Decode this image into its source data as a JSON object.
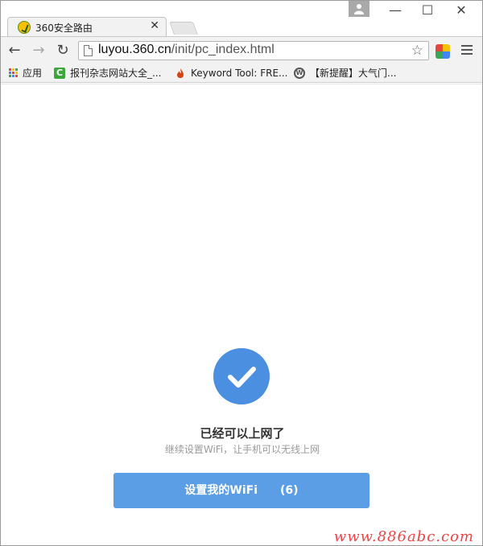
{
  "browser": {
    "tab": {
      "title": "360安全路由",
      "close": "✕"
    },
    "window_controls": {
      "minimize": "—",
      "maximize": "☐",
      "close": "✕"
    },
    "toolbar": {
      "back": "←",
      "forward": "→",
      "reload": "↻",
      "url_host": "luyou.360.cn",
      "url_path": "/init/pc_index.html",
      "star": "☆"
    },
    "bookmarks": [
      {
        "label": "应用",
        "icon": "apps-grid-icon"
      },
      {
        "label": "报刊杂志网站大全_...",
        "icon": "c-icon"
      },
      {
        "label": "Keyword Tool: FRE...",
        "icon": "flame-icon"
      },
      {
        "label": "【新提醒】大气门...",
        "icon": "wordpress-icon"
      }
    ]
  },
  "page": {
    "status_title": "已经可以上网了",
    "status_subtitle": "继续设置WiFi，让手机可以无线上网",
    "wifi_button_label": "设置我的WiFi",
    "wifi_button_count": "(6)",
    "watermark": "www.886abc.com"
  },
  "colors": {
    "accent": "#4a8fe0",
    "button": "#5b9ee6"
  }
}
